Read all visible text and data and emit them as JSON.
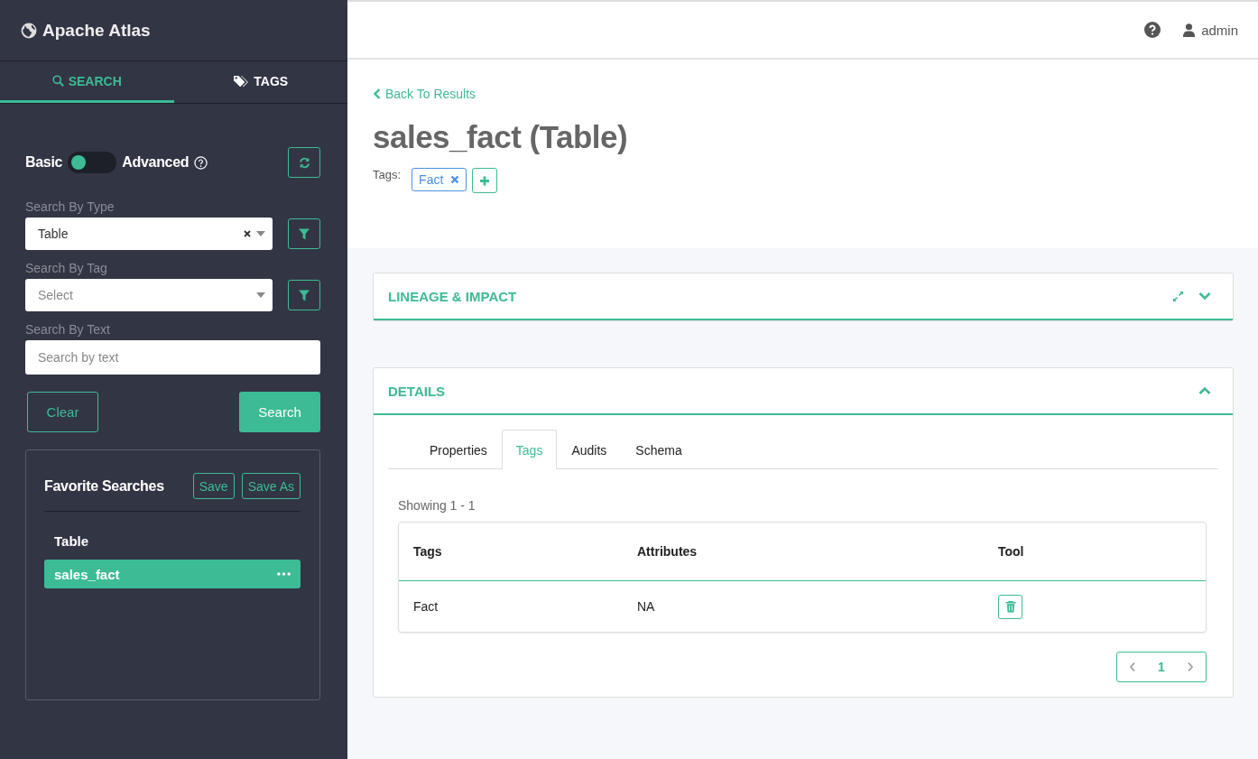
{
  "app": {
    "name": "Apache Atlas"
  },
  "sidebar": {
    "tabs": [
      {
        "label": "SEARCH",
        "selected": true
      },
      {
        "label": "TAGS",
        "selected": false
      }
    ],
    "mode": {
      "basic_label": "Basic",
      "advanced_label": "Advanced",
      "advanced": false
    },
    "search_by_type": {
      "label": "Search By Type",
      "value": "Table"
    },
    "search_by_tag": {
      "label": "Search By Tag",
      "placeholder": "Select"
    },
    "search_by_text": {
      "label": "Search By Text",
      "placeholder": "Search by text"
    },
    "buttons": {
      "clear": "Clear",
      "search": "Search"
    },
    "favorites": {
      "title": "Favorite Searches",
      "save": "Save",
      "save_as": "Save As",
      "group": "Table",
      "items": [
        {
          "label": "sales_fact",
          "selected": true
        }
      ]
    }
  },
  "header": {
    "user": "admin"
  },
  "entity": {
    "back_link": "Back To Results",
    "title": "sales_fact (Table)",
    "tags_label": "Tags:",
    "tags": [
      {
        "label": "Fact"
      }
    ]
  },
  "lineage": {
    "title": "LINEAGE & IMPACT",
    "expanded": false
  },
  "details": {
    "title": "DETAILS",
    "expanded": true,
    "tabs": [
      {
        "label": "Properties",
        "selected": false
      },
      {
        "label": "Tags",
        "selected": true
      },
      {
        "label": "Audits",
        "selected": false
      },
      {
        "label": "Schema",
        "selected": false
      }
    ],
    "showing": "Showing 1 - 1",
    "table": {
      "columns": [
        "Tags",
        "Attributes",
        "Tool"
      ],
      "rows": [
        {
          "tag": "Fact",
          "attributes": "NA"
        }
      ]
    },
    "pagination": {
      "current": "1"
    }
  }
}
